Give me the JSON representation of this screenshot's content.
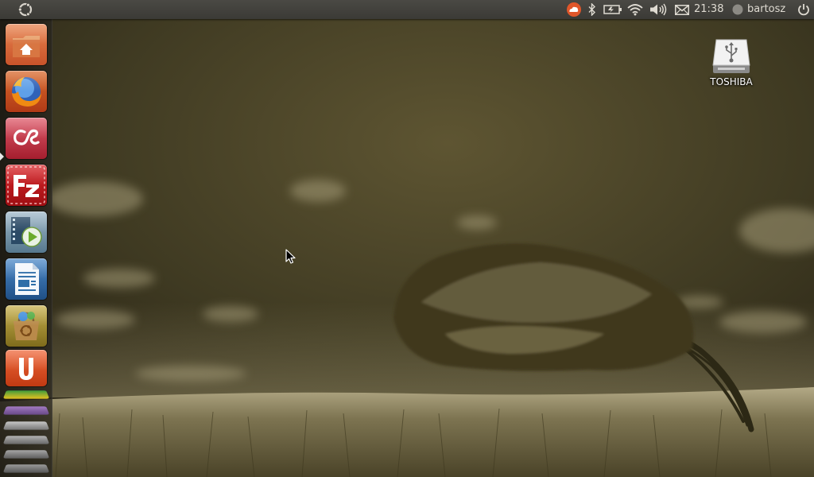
{
  "panel": {
    "clock": "21:38",
    "user": "bartosz",
    "indicators": [
      "ubuntu-one-icon",
      "bluetooth-icon",
      "battery-icon",
      "wifi-icon",
      "volume-icon",
      "mail-icon",
      "user-status-icon",
      "power-icon"
    ]
  },
  "launcher": {
    "items": [
      {
        "name": "Home Folder",
        "icon": "home-folder-icon",
        "color": "#d35f2e"
      },
      {
        "name": "Firefox",
        "icon": "firefox-icon",
        "color": "#c63d14"
      },
      {
        "name": "Last.fm",
        "icon": "lastfm-icon",
        "color": "#c12a3a"
      },
      {
        "name": "FileZilla",
        "icon": "filezilla-icon",
        "color": "#b8141a"
      },
      {
        "name": "Movie Player",
        "icon": "movie-player-icon",
        "color": "#6f8fa6"
      },
      {
        "name": "LibreOffice Writer",
        "icon": "writer-icon",
        "color": "#2f6ea8"
      },
      {
        "name": "Ubuntu Software Center",
        "icon": "software-center-icon",
        "color": "#a9932c"
      },
      {
        "name": "Ubuntu One",
        "icon": "ubuntu-one-launcher-icon",
        "color": "#d6491e"
      }
    ],
    "running_item_index": 2
  },
  "desktop": {
    "icons": [
      {
        "label": "TOSHIBA",
        "icon": "usb-drive-icon"
      }
    ]
  }
}
